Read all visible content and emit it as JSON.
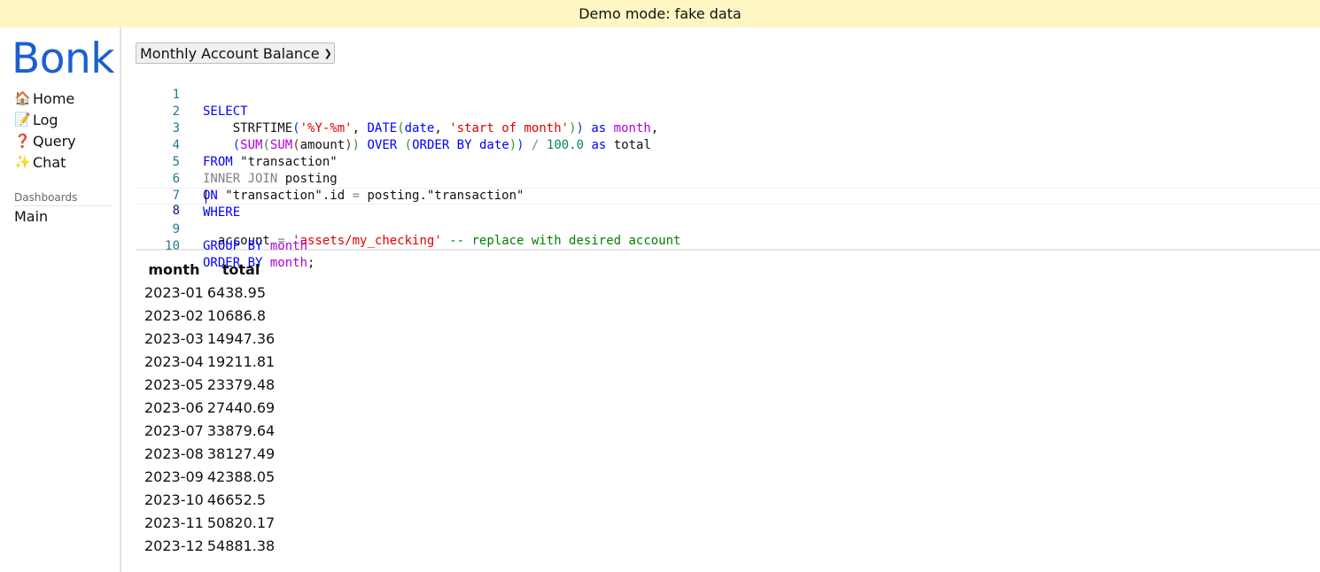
{
  "banner": {
    "text": "Demo mode: fake data"
  },
  "sidebar": {
    "logo": "Bonk",
    "nav": [
      {
        "icon": "🏠",
        "icon_name": "home-icon",
        "label": "Home"
      },
      {
        "icon": "📝",
        "icon_name": "memo-icon",
        "label": "Log"
      },
      {
        "icon": "❓",
        "icon_name": "question-icon",
        "label": "Query"
      },
      {
        "icon": "✨",
        "icon_name": "sparkles-icon",
        "label": "Chat"
      }
    ],
    "dashboards_heading": "Dashboards",
    "dashboards": [
      {
        "label": "Main"
      }
    ]
  },
  "query": {
    "selected": "Monthly Account Balance",
    "line_numbers": [
      "1",
      "2",
      "3",
      "4",
      "5",
      "6",
      "7",
      "8",
      "9",
      "10"
    ]
  },
  "results": {
    "columns": [
      "month",
      "total"
    ],
    "rows": [
      [
        "2023-01",
        "6438.95"
      ],
      [
        "2023-02",
        "10686.8"
      ],
      [
        "2023-03",
        "14947.36"
      ],
      [
        "2023-04",
        "19211.81"
      ],
      [
        "2023-05",
        "23379.48"
      ],
      [
        "2023-06",
        "27440.69"
      ],
      [
        "2023-07",
        "33879.64"
      ],
      [
        "2023-08",
        "38127.49"
      ],
      [
        "2023-09",
        "42388.05"
      ],
      [
        "2023-10",
        "46652.5"
      ],
      [
        "2023-11",
        "50820.17"
      ],
      [
        "2023-12",
        "54881.38"
      ]
    ]
  },
  "colors": {
    "banner_bg": "#fef7c3",
    "logo": "#1b5fd1",
    "keyword": "#0000ff",
    "string": "#e00000",
    "comment": "#008000",
    "number": "#098658",
    "line_number": "#237893"
  }
}
